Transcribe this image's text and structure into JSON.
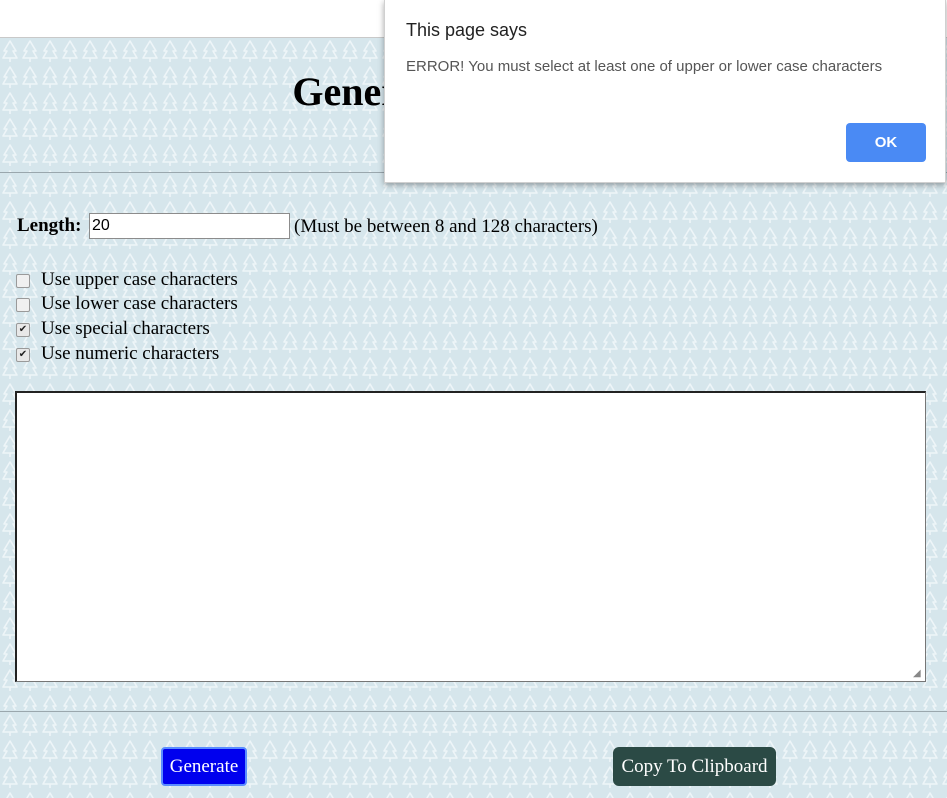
{
  "page": {
    "title": "Generate a Password",
    "length_label": "Length:",
    "length_value": "20",
    "length_hint": "(Must be between 8 and 128 characters)",
    "options": [
      {
        "label": "Use upper case characters",
        "checked": false
      },
      {
        "label": "Use lower case characters",
        "checked": false
      },
      {
        "label": "Use special characters",
        "checked": true
      },
      {
        "label": "Use numeric characters",
        "checked": true
      }
    ],
    "output_value": "",
    "generate_label": "Generate",
    "copy_label": "Copy To Clipboard"
  },
  "dialog": {
    "title": "This page says",
    "message": "ERROR! You must select at least one of upper or lower case characters",
    "ok_label": "OK"
  },
  "colors": {
    "background": "#d6e6ec",
    "generate_button": "#0000ee",
    "copy_button": "#2b4a45",
    "ok_button": "#4a8af4"
  }
}
